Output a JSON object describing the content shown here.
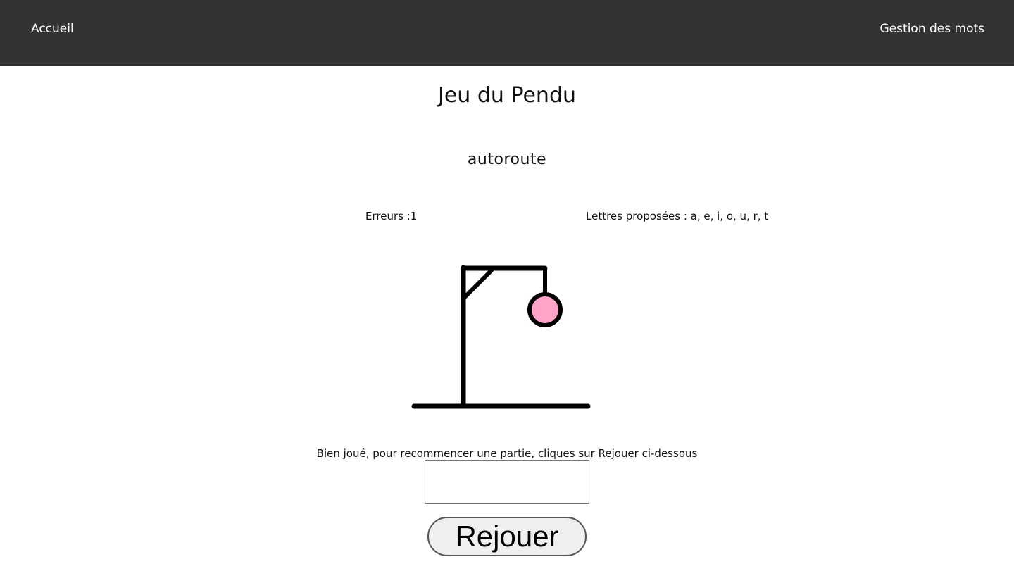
{
  "nav": {
    "home_label": "Accueil",
    "words_label": "Gestion des mots"
  },
  "game": {
    "title": "Jeu du Pendu",
    "word": "autoroute",
    "errors_text": "Erreurs :1",
    "letters_text": "Lettres proposées : a, e, i, o, u, r, t",
    "message": "Bien joué, pour recommencer une partie, cliques sur Rejouer ci-dessous",
    "input_value": "",
    "replay_label": "Rejouer"
  },
  "colors": {
    "navbar_bg": "#333333",
    "head_fill": "#ffa3c8",
    "stroke": "#000000"
  },
  "icons": {
    "hangman": "hangman-gallows-with-head"
  }
}
